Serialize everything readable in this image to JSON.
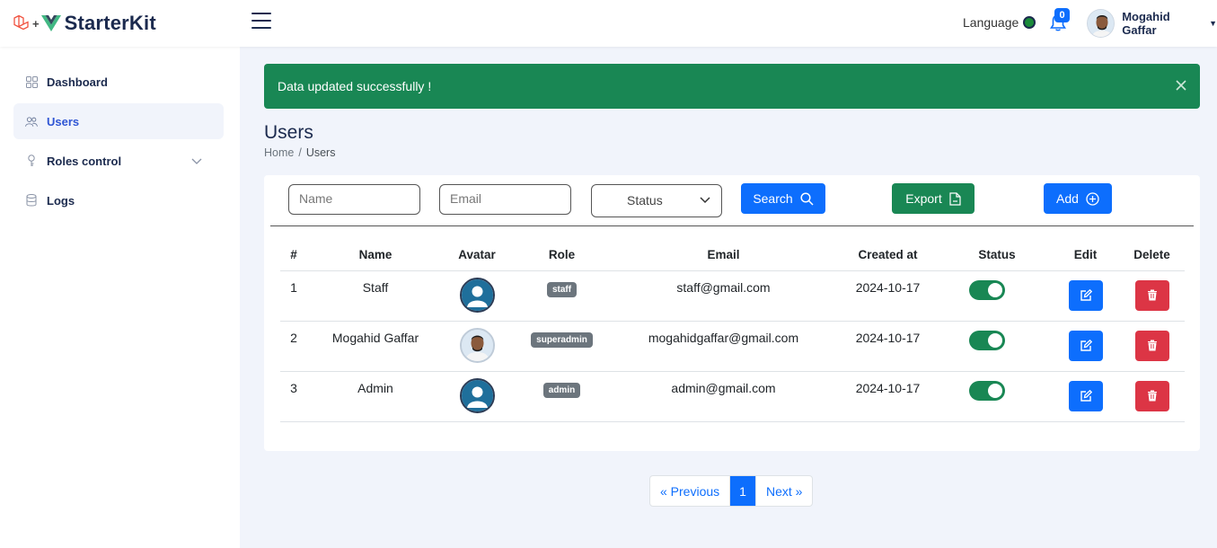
{
  "app": {
    "brand": "StarterKit",
    "plus": "+"
  },
  "header": {
    "language": "Language",
    "notifications_count": "0",
    "user_name": "Mogahid Gaffar"
  },
  "sidebar": {
    "items": [
      {
        "label": "Dashboard",
        "icon": "grid-icon"
      },
      {
        "label": "Users",
        "icon": "users-icon",
        "active": true
      },
      {
        "label": "Roles control",
        "icon": "key-icon",
        "has_submenu": true
      },
      {
        "label": "Logs",
        "icon": "database-icon"
      }
    ]
  },
  "alert": {
    "message": "Data updated successfully !"
  },
  "page": {
    "title": "Users",
    "breadcrumb": {
      "home": "Home",
      "sep": "/",
      "current": "Users"
    }
  },
  "filters": {
    "name_placeholder": "Name",
    "email_placeholder": "Email",
    "status_label": "Status",
    "search_label": "Search",
    "export_label": "Export",
    "add_label": "Add"
  },
  "table": {
    "headers": [
      "#",
      "Name",
      "Avatar",
      "Role",
      "Email",
      "Created at",
      "Status",
      "Edit",
      "Delete"
    ],
    "rows": [
      {
        "id": "1",
        "name": "Staff",
        "avatar": "default-avatar",
        "role": "staff",
        "email": "staff@gmail.com",
        "created_at": "2024-10-17",
        "status": true
      },
      {
        "id": "2",
        "name": "Mogahid Gaffar",
        "avatar": "photo-avatar",
        "role": "superadmin",
        "email": "mogahidgaffar@gmail.com",
        "created_at": "2024-10-17",
        "status": true
      },
      {
        "id": "3",
        "name": "Admin",
        "avatar": "default-avatar",
        "role": "admin",
        "email": "admin@gmail.com",
        "created_at": "2024-10-17",
        "status": true
      }
    ]
  },
  "pagination": {
    "previous": "« Previous",
    "current": "1",
    "next": "Next »"
  },
  "colors": {
    "primary": "#0d6efd",
    "success": "#198754",
    "danger": "#dc3545",
    "secondary": "#6c757d",
    "navy": "#1b2a4e"
  }
}
